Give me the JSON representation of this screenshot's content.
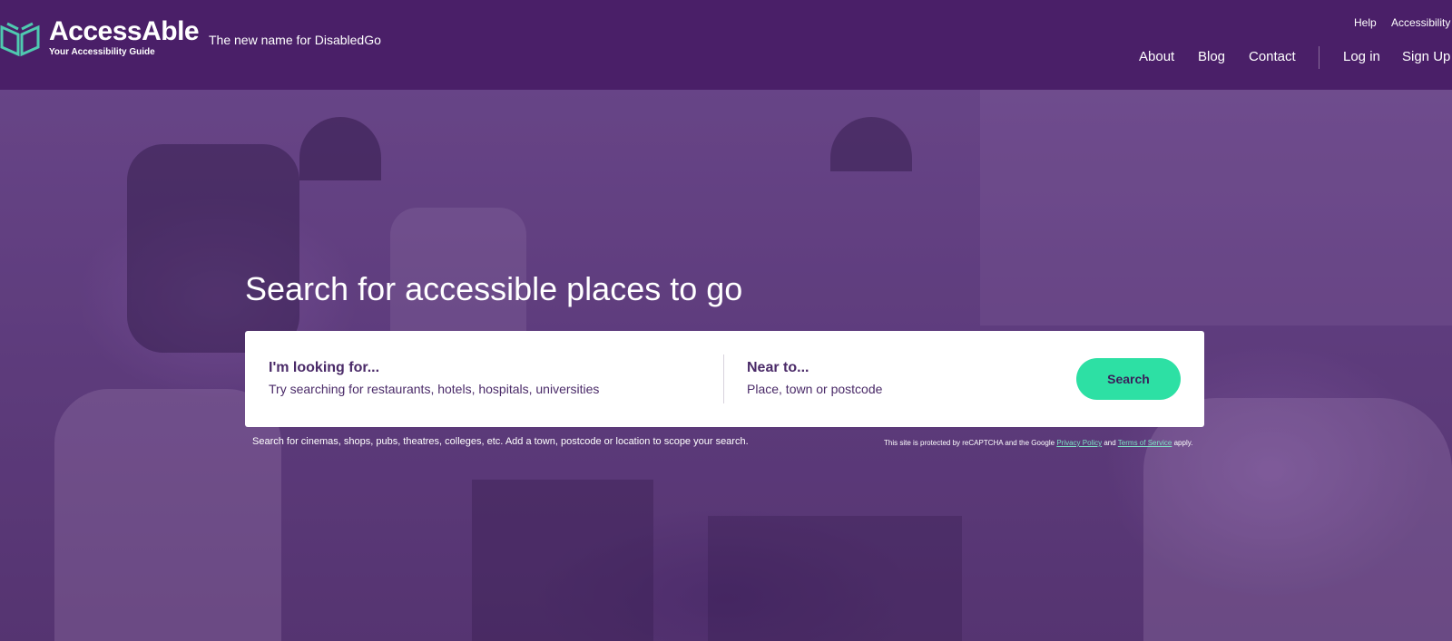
{
  "header": {
    "brand": "AccessAble",
    "brand_sub": "Your Accessibility Guide",
    "tagline": "The new name for DisabledGo",
    "util_links": [
      "Help",
      "Accessibility"
    ],
    "nav": [
      "About",
      "Blog",
      "Contact"
    ],
    "account": [
      "Log in",
      "Sign Up"
    ]
  },
  "hero": {
    "title": "Search for accessible places to go",
    "looking_label": "I'm looking for...",
    "looking_placeholder": "Try searching for restaurants, hotels, hospitals, universities",
    "near_label": "Near to...",
    "near_placeholder": "Place, town or postcode",
    "search_button": "Search",
    "hint": "Search for cinemas, shops, pubs, theatres, colleges, etc. Add a town, postcode or location to scope your search.",
    "recaptcha_prefix": "This site is protected by reCAPTCHA and the Google",
    "privacy_link": "Privacy Policy",
    "recaptcha_and": "and",
    "terms_link": "Terms of Service",
    "recaptcha_suffix": "apply."
  },
  "colors": {
    "header_bg": "#4a1f68",
    "accent_green": "#2de0a4",
    "logo_teal": "#4fc9b0"
  },
  "icons": {
    "logo": "book-shield-icon"
  }
}
